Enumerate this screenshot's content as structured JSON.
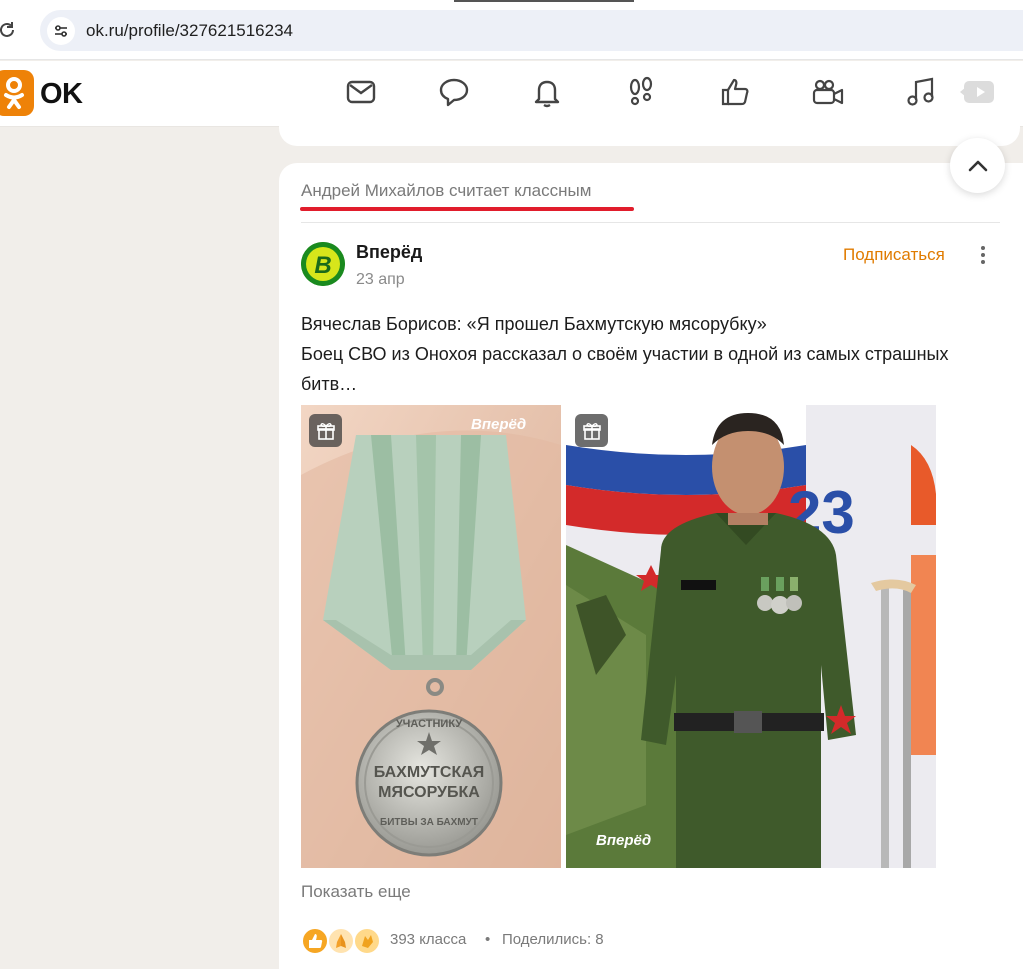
{
  "browser": {
    "url": "ok.ru/profile/327621516234"
  },
  "header": {
    "logo_text": "OK",
    "nav_icons": [
      "mail-icon",
      "chat-icon",
      "bell-icon",
      "footprints-icon",
      "like-icon",
      "video-camera-icon",
      "music-icon",
      "video-play-icon"
    ]
  },
  "feed_card": {
    "liked_by_text": "Андрей Михайлов считает классным",
    "group_name": "Вперёд",
    "post_date": "23 апр",
    "subscribe_label": "Подписаться",
    "text_line_1": "Вячеслав Борисов: «Я прошел Бахмутскую мясорубку»",
    "text_line_2": "Боец СВО из Онохоя рассказал  о своём участии в одной из самых страшных",
    "text_line_3": "битв…",
    "photo_1": {
      "watermark": "Вперёд",
      "medal_top": "УЧАСТНИКУ",
      "medal_line_1": "БАХМУТСКАЯ",
      "medal_line_2": "МЯСОРУБКА",
      "medal_bottom": "БИТВЫ ЗА БАХМУТ"
    },
    "photo_2": {
      "watermark": "Вперёд",
      "banner_number": "23"
    },
    "show_more_label": "Показать еще",
    "reactions_count": "393 класса",
    "separator": "•",
    "shares_label": "Поделились: 8"
  },
  "colors": {
    "accent_orange": "#ee8208",
    "underline_red": "#e11d2c",
    "subscribe_orange": "#e07b00"
  }
}
